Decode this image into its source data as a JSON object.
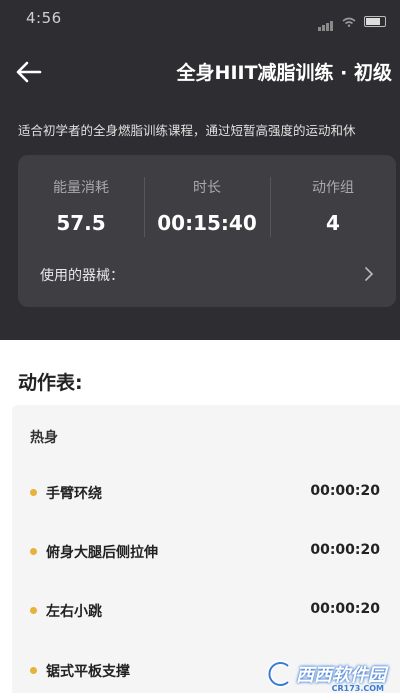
{
  "status_bar": {
    "time": "4:56"
  },
  "header": {
    "title": "全身HIIT减脂训练 · 初级",
    "description": "适合初学者的全身燃脂训练课程，通过短暂高强度的运动和休"
  },
  "summary": {
    "stats": [
      {
        "label": "能量消耗",
        "value": "57.5"
      },
      {
        "label": "时长",
        "value": "00:15:40"
      },
      {
        "label": "动作组",
        "value": "4"
      }
    ],
    "equipment_label": "使用的器械："
  },
  "exercise_table": {
    "title": "动作表:",
    "group": "热身",
    "items": [
      {
        "name": "手臂环绕",
        "time": "00:00:20"
      },
      {
        "name": "俯身大腿后侧拉伸",
        "time": "00:00:20"
      },
      {
        "name": "左右小跳",
        "time": "00:00:20"
      },
      {
        "name": "锯式平板支撑",
        "time": ""
      }
    ]
  },
  "watermark": {
    "text": "西西软件园",
    "sub": "CR173.COM"
  },
  "colors": {
    "hero_bg": "#2e2d31",
    "card_bg": "#3f3e43",
    "bullet": "#e6b23a"
  }
}
